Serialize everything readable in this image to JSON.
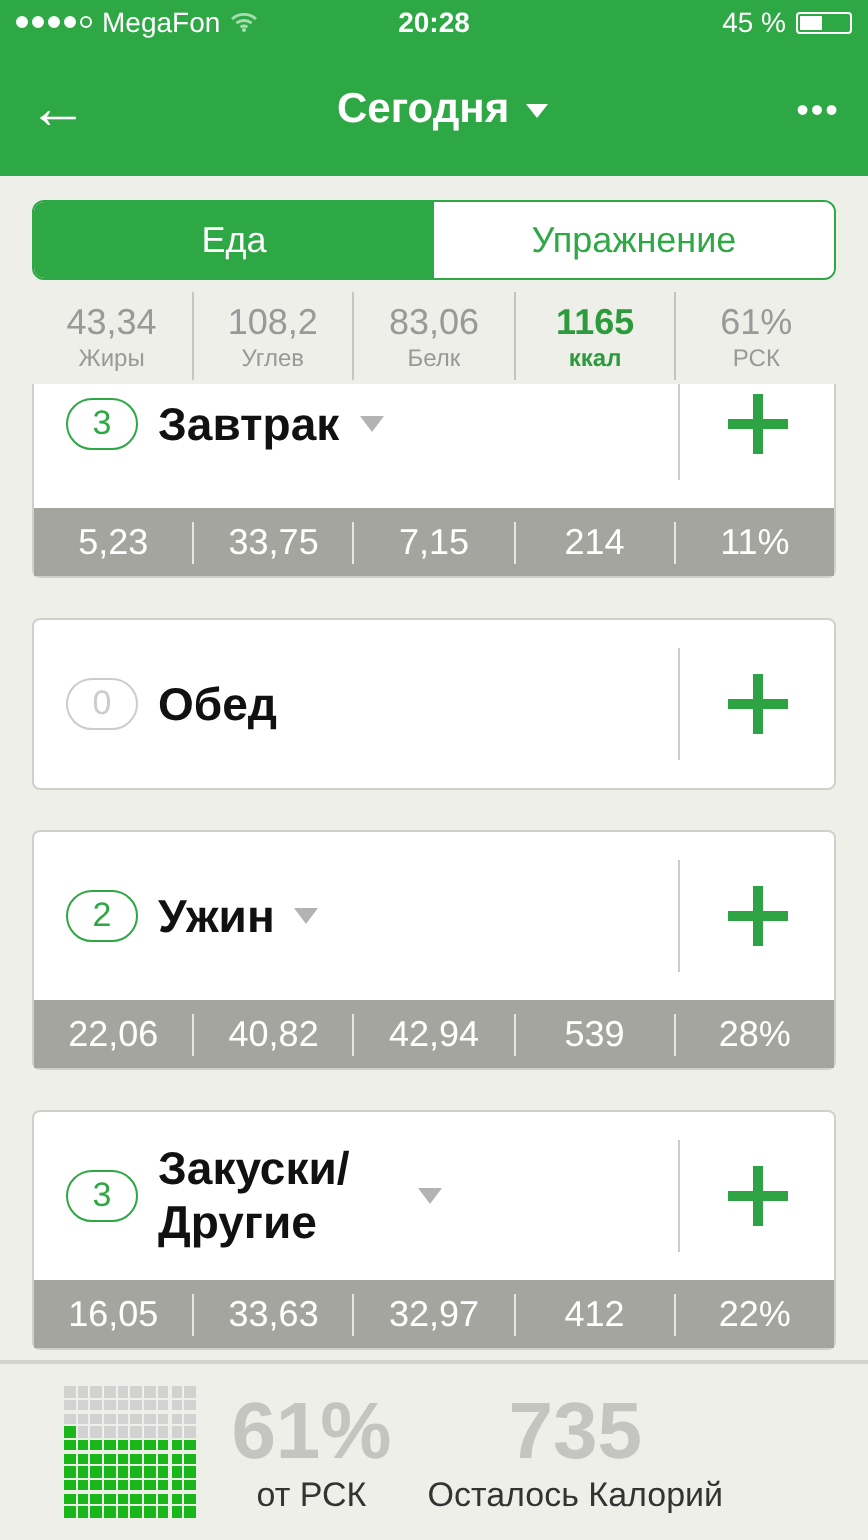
{
  "status_bar": {
    "carrier": "MegaFon",
    "time": "20:28",
    "battery_text": "45 %",
    "battery": {
      "level": 0.45
    }
  },
  "nav": {
    "back": "←",
    "title": "Сегодня",
    "more": "•••"
  },
  "tabs": [
    {
      "label": "Еда",
      "selected": true
    },
    {
      "label": "Упражнение",
      "selected": false
    }
  ],
  "summary": [
    {
      "value": "43,34",
      "label": "Жиры",
      "highlighted": false
    },
    {
      "value": "108,2",
      "label": "Углев",
      "highlighted": false
    },
    {
      "value": "83,06",
      "label": "Белк",
      "highlighted": false
    },
    {
      "value": "1165",
      "label": "ккал",
      "highlighted": true
    },
    {
      "value": "61%",
      "label": "РСК",
      "highlighted": false
    }
  ],
  "meals": [
    {
      "count": "3",
      "name": "Завтрак",
      "active": true,
      "has_menu": true,
      "totals": [
        "5,23",
        "33,75",
        "7,15",
        "214",
        "11%"
      ]
    },
    {
      "count": "0",
      "name": "Обед",
      "active": false,
      "has_menu": false
    },
    {
      "count": "2",
      "name": "Ужин",
      "active": true,
      "has_menu": true,
      "totals": [
        "22,06",
        "40,82",
        "42,94",
        "539",
        "28%"
      ]
    },
    {
      "count": "3",
      "name": "Закуски/ Другие",
      "active": true,
      "has_menu": true,
      "totals": [
        "16,05",
        "33,63",
        "32,97",
        "412",
        "22%"
      ]
    }
  ],
  "footer": {
    "percent": "61%",
    "percent_label": "от РСК",
    "remaining": "735",
    "remaining_label": "Осталось Калорий"
  }
}
